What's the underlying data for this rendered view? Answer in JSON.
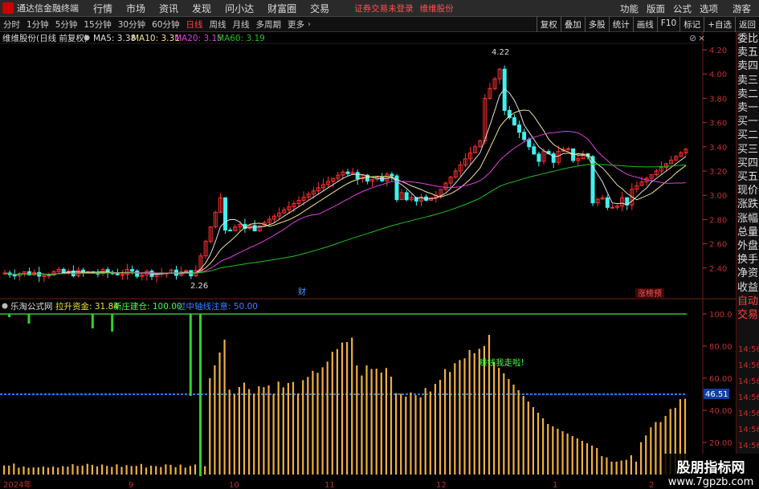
{
  "app": {
    "name": "通达信金融终端"
  },
  "menu": [
    "行情",
    "市场",
    "资讯",
    "发现",
    "问小达",
    "财富圈",
    "交易"
  ],
  "notice": {
    "text1": "证券交易未登录",
    "text2": "维维股份"
  },
  "top_right": [
    "功能",
    "版面",
    "公式",
    "选项",
    "游客"
  ],
  "periods": [
    "分时",
    "1分钟",
    "5分钟",
    "15分钟",
    "30分钟",
    "60分钟",
    "日线",
    "周线",
    "月线",
    "多周期",
    "更多"
  ],
  "active_period": "日线",
  "tools": [
    "复权",
    "叠加",
    "多股",
    "统计",
    "画线",
    "F10",
    "标记",
    "+自选",
    "返回"
  ],
  "main": {
    "title": "维维股份(日线 前复权)",
    "ma": [
      {
        "label": "MA5: 3.38",
        "color": "#e0e0e0"
      },
      {
        "label": "MA10: 3.31",
        "color": "#f0e68c"
      },
      {
        "label": "MA20: 3.15",
        "color": "#e040e0"
      },
      {
        "label": "MA60: 3.19",
        "color": "#20c020"
      }
    ],
    "high_label": "4.22",
    "low_label": "2.26",
    "fin_marker": "财",
    "rank_marker": "涨榜预",
    "y_ticks": [
      "4.20",
      "4.00",
      "3.80",
      "3.60",
      "3.40",
      "3.20",
      "3.00",
      "2.80",
      "2.60",
      "2.40"
    ]
  },
  "indicator": {
    "name": "乐淘公式网",
    "line1": "拉升资金: 31.84",
    "line2": "新庄建仓: 100.00",
    "line3": "过中轴线注意: 50.00",
    "annot": "赚钱我走啦!",
    "right_value": "46.51",
    "y_ticks": [
      "100.0",
      "80.00",
      "60.00",
      "40.00",
      "20.00"
    ]
  },
  "x_labels": [
    "2024年",
    "9",
    "10",
    "11",
    "12",
    "1",
    "2"
  ],
  "side_labels": [
    "委比",
    "卖五",
    "卖四",
    "卖三",
    "卖二",
    "卖一",
    "买一",
    "买二",
    "买三",
    "买四",
    "买五",
    "现价",
    "涨跌",
    "涨幅",
    "总量",
    "外盘",
    "换手",
    "净资",
    "收益",
    "自动",
    "交易"
  ],
  "time_labels": [
    "14:56",
    "14:56",
    "14:56",
    "14:56",
    "14:56",
    "14:56",
    "14:56"
  ],
  "watermark": {
    "line1": "股朋指标网",
    "line2": "www.7gpzb.com"
  },
  "colors": {
    "up": "#ff3030",
    "down": "#40f0f0",
    "accent": "#ff4040"
  }
}
